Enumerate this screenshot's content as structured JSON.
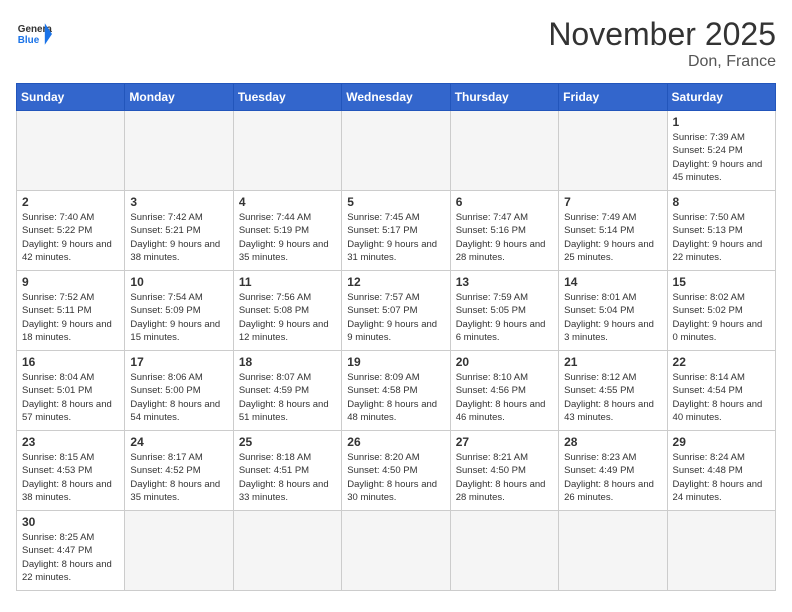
{
  "header": {
    "logo_general": "General",
    "logo_blue": "Blue",
    "month_title": "November 2025",
    "location": "Don, France"
  },
  "days_of_week": [
    "Sunday",
    "Monday",
    "Tuesday",
    "Wednesday",
    "Thursday",
    "Friday",
    "Saturday"
  ],
  "weeks": [
    [
      {
        "day": "",
        "info": ""
      },
      {
        "day": "",
        "info": ""
      },
      {
        "day": "",
        "info": ""
      },
      {
        "day": "",
        "info": ""
      },
      {
        "day": "",
        "info": ""
      },
      {
        "day": "",
        "info": ""
      },
      {
        "day": "1",
        "info": "Sunrise: 7:39 AM\nSunset: 5:24 PM\nDaylight: 9 hours and 45 minutes."
      }
    ],
    [
      {
        "day": "2",
        "info": "Sunrise: 7:40 AM\nSunset: 5:22 PM\nDaylight: 9 hours and 42 minutes."
      },
      {
        "day": "3",
        "info": "Sunrise: 7:42 AM\nSunset: 5:21 PM\nDaylight: 9 hours and 38 minutes."
      },
      {
        "day": "4",
        "info": "Sunrise: 7:44 AM\nSunset: 5:19 PM\nDaylight: 9 hours and 35 minutes."
      },
      {
        "day": "5",
        "info": "Sunrise: 7:45 AM\nSunset: 5:17 PM\nDaylight: 9 hours and 31 minutes."
      },
      {
        "day": "6",
        "info": "Sunrise: 7:47 AM\nSunset: 5:16 PM\nDaylight: 9 hours and 28 minutes."
      },
      {
        "day": "7",
        "info": "Sunrise: 7:49 AM\nSunset: 5:14 PM\nDaylight: 9 hours and 25 minutes."
      },
      {
        "day": "8",
        "info": "Sunrise: 7:50 AM\nSunset: 5:13 PM\nDaylight: 9 hours and 22 minutes."
      }
    ],
    [
      {
        "day": "9",
        "info": "Sunrise: 7:52 AM\nSunset: 5:11 PM\nDaylight: 9 hours and 18 minutes."
      },
      {
        "day": "10",
        "info": "Sunrise: 7:54 AM\nSunset: 5:09 PM\nDaylight: 9 hours and 15 minutes."
      },
      {
        "day": "11",
        "info": "Sunrise: 7:56 AM\nSunset: 5:08 PM\nDaylight: 9 hours and 12 minutes."
      },
      {
        "day": "12",
        "info": "Sunrise: 7:57 AM\nSunset: 5:07 PM\nDaylight: 9 hours and 9 minutes."
      },
      {
        "day": "13",
        "info": "Sunrise: 7:59 AM\nSunset: 5:05 PM\nDaylight: 9 hours and 6 minutes."
      },
      {
        "day": "14",
        "info": "Sunrise: 8:01 AM\nSunset: 5:04 PM\nDaylight: 9 hours and 3 minutes."
      },
      {
        "day": "15",
        "info": "Sunrise: 8:02 AM\nSunset: 5:02 PM\nDaylight: 9 hours and 0 minutes."
      }
    ],
    [
      {
        "day": "16",
        "info": "Sunrise: 8:04 AM\nSunset: 5:01 PM\nDaylight: 8 hours and 57 minutes."
      },
      {
        "day": "17",
        "info": "Sunrise: 8:06 AM\nSunset: 5:00 PM\nDaylight: 8 hours and 54 minutes."
      },
      {
        "day": "18",
        "info": "Sunrise: 8:07 AM\nSunset: 4:59 PM\nDaylight: 8 hours and 51 minutes."
      },
      {
        "day": "19",
        "info": "Sunrise: 8:09 AM\nSunset: 4:58 PM\nDaylight: 8 hours and 48 minutes."
      },
      {
        "day": "20",
        "info": "Sunrise: 8:10 AM\nSunset: 4:56 PM\nDaylight: 8 hours and 46 minutes."
      },
      {
        "day": "21",
        "info": "Sunrise: 8:12 AM\nSunset: 4:55 PM\nDaylight: 8 hours and 43 minutes."
      },
      {
        "day": "22",
        "info": "Sunrise: 8:14 AM\nSunset: 4:54 PM\nDaylight: 8 hours and 40 minutes."
      }
    ],
    [
      {
        "day": "23",
        "info": "Sunrise: 8:15 AM\nSunset: 4:53 PM\nDaylight: 8 hours and 38 minutes."
      },
      {
        "day": "24",
        "info": "Sunrise: 8:17 AM\nSunset: 4:52 PM\nDaylight: 8 hours and 35 minutes."
      },
      {
        "day": "25",
        "info": "Sunrise: 8:18 AM\nSunset: 4:51 PM\nDaylight: 8 hours and 33 minutes."
      },
      {
        "day": "26",
        "info": "Sunrise: 8:20 AM\nSunset: 4:50 PM\nDaylight: 8 hours and 30 minutes."
      },
      {
        "day": "27",
        "info": "Sunrise: 8:21 AM\nSunset: 4:50 PM\nDaylight: 8 hours and 28 minutes."
      },
      {
        "day": "28",
        "info": "Sunrise: 8:23 AM\nSunset: 4:49 PM\nDaylight: 8 hours and 26 minutes."
      },
      {
        "day": "29",
        "info": "Sunrise: 8:24 AM\nSunset: 4:48 PM\nDaylight: 8 hours and 24 minutes."
      }
    ],
    [
      {
        "day": "30",
        "info": "Sunrise: 8:25 AM\nSunset: 4:47 PM\nDaylight: 8 hours and 22 minutes."
      },
      {
        "day": "",
        "info": ""
      },
      {
        "day": "",
        "info": ""
      },
      {
        "day": "",
        "info": ""
      },
      {
        "day": "",
        "info": ""
      },
      {
        "day": "",
        "info": ""
      },
      {
        "day": "",
        "info": ""
      }
    ]
  ]
}
